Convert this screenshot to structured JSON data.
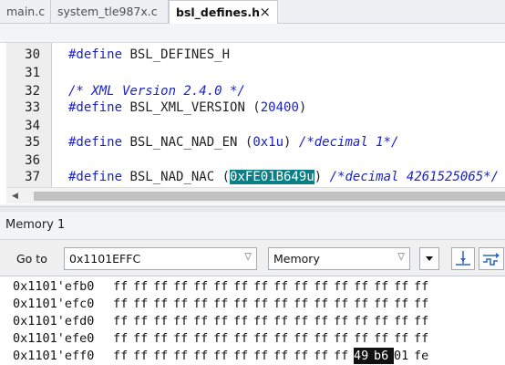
{
  "tabs": [
    {
      "label": "main.c",
      "active": false
    },
    {
      "label": "system_tle987x.c",
      "active": false
    },
    {
      "label": "bsl_defines.h",
      "active": true,
      "close": "×"
    }
  ],
  "editor": {
    "lines": [
      {
        "num": "30",
        "parts": [
          {
            "t": "#define",
            "c": "kw"
          },
          {
            "t": " BSL_DEFINES_H",
            "c": ""
          }
        ]
      },
      {
        "num": "31",
        "parts": []
      },
      {
        "num": "32",
        "parts": [
          {
            "t": "/* XML Version 2.4.0 */",
            "c": "cm"
          }
        ]
      },
      {
        "num": "33",
        "parts": [
          {
            "t": "#define",
            "c": "kw"
          },
          {
            "t": " BSL_XML_VERSION (",
            "c": ""
          },
          {
            "t": "20400",
            "c": "num"
          },
          {
            "t": ")",
            "c": ""
          }
        ]
      },
      {
        "num": "34",
        "parts": []
      },
      {
        "num": "35",
        "parts": [
          {
            "t": "#define",
            "c": "kw"
          },
          {
            "t": " BSL_NAC_NAD_EN (",
            "c": ""
          },
          {
            "t": "0x1u",
            "c": "num"
          },
          {
            "t": ") ",
            "c": ""
          },
          {
            "t": "/*decimal 1*/",
            "c": "cm"
          }
        ]
      },
      {
        "num": "36",
        "parts": []
      },
      {
        "num": "37",
        "parts": [
          {
            "t": "#define",
            "c": "kw"
          },
          {
            "t": " BSL_NAD_NAC (",
            "c": ""
          },
          {
            "t": "0xFE01B649u",
            "c": "sel"
          },
          {
            "t": ") ",
            "c": ""
          },
          {
            "t": "/*decimal 4261525065*/",
            "c": "cm"
          }
        ]
      }
    ]
  },
  "memory": {
    "title": "Memory 1",
    "goto_label": "Go to",
    "address": "0x1101EFFC",
    "view_type": "Memory",
    "rows": [
      {
        "addr": "0x1101'efb0",
        "bytes": [
          "ff",
          "ff",
          "ff",
          "ff",
          "ff",
          "ff",
          "ff",
          "ff",
          "ff",
          "ff",
          "ff",
          "ff",
          "ff",
          "ff",
          "ff",
          "ff"
        ]
      },
      {
        "addr": "0x1101'efc0",
        "bytes": [
          "ff",
          "ff",
          "ff",
          "ff",
          "ff",
          "ff",
          "ff",
          "ff",
          "ff",
          "ff",
          "ff",
          "ff",
          "ff",
          "ff",
          "ff",
          "ff"
        ]
      },
      {
        "addr": "0x1101'efd0",
        "bytes": [
          "ff",
          "ff",
          "ff",
          "ff",
          "ff",
          "ff",
          "ff",
          "ff",
          "ff",
          "ff",
          "ff",
          "ff",
          "ff",
          "ff",
          "ff",
          "ff"
        ]
      },
      {
        "addr": "0x1101'efe0",
        "bytes": [
          "ff",
          "ff",
          "ff",
          "ff",
          "ff",
          "ff",
          "ff",
          "ff",
          "ff",
          "ff",
          "ff",
          "ff",
          "ff",
          "ff",
          "ff",
          "ff"
        ]
      },
      {
        "addr": "0x1101'eff0",
        "bytes": [
          "ff",
          "ff",
          "ff",
          "ff",
          "ff",
          "ff",
          "ff",
          "ff",
          "ff",
          "ff",
          "ff",
          "ff",
          "49",
          "b6",
          "01",
          "fe"
        ],
        "highlight": [
          12,
          13
        ]
      }
    ]
  },
  "colors": {
    "selection": "#0a7f86",
    "keyword": "#1b22c4",
    "byte_highlight": "#111111"
  }
}
